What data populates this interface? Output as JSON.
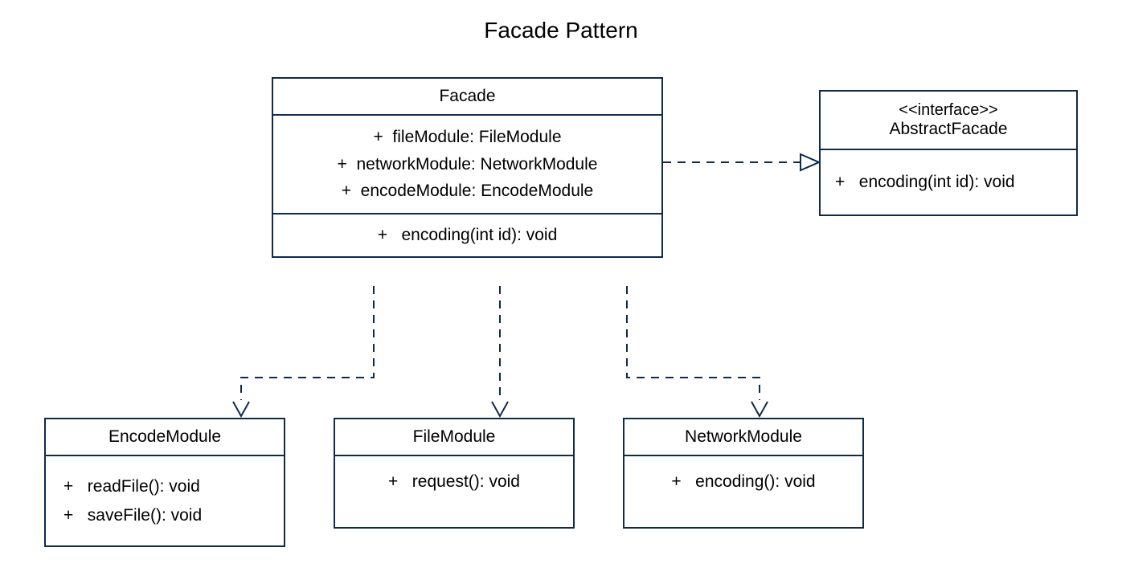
{
  "title": "Facade Pattern",
  "facade": {
    "name": "Facade",
    "attr1": "+  fileModule: FileModule",
    "attr2": "+  networkModule: NetworkModule",
    "attr3": "+  encodeModule: EncodeModule",
    "method1": "+   encoding(int id): void"
  },
  "abstractFacade": {
    "stereotype": "<<interface>>",
    "name": "AbstractFacade",
    "method1": "+   encoding(int id): void"
  },
  "encodeModule": {
    "name": "EncodeModule",
    "method1": "+   readFile(): void",
    "method2": "+   saveFile(): void"
  },
  "fileModule": {
    "name": "FileModule",
    "method1": "+   request(): void"
  },
  "networkModule": {
    "name": "NetworkModule",
    "method1": "+   encoding(): void"
  }
}
